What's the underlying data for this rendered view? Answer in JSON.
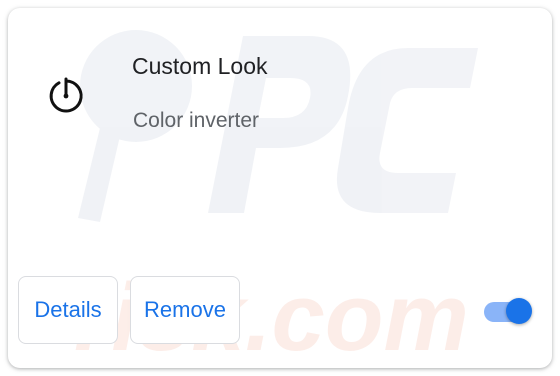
{
  "extension": {
    "name": "Custom Look",
    "description": "Color inverter",
    "icon": "gauge-icon",
    "enabled": true
  },
  "actions": {
    "details_label": "Details",
    "remove_label": "Remove"
  },
  "colors": {
    "accent": "#1a73e8",
    "toggle_track": "#8ab4f8",
    "name_text": "#202124",
    "description_text": "#5f6368",
    "border": "#dadce0"
  }
}
